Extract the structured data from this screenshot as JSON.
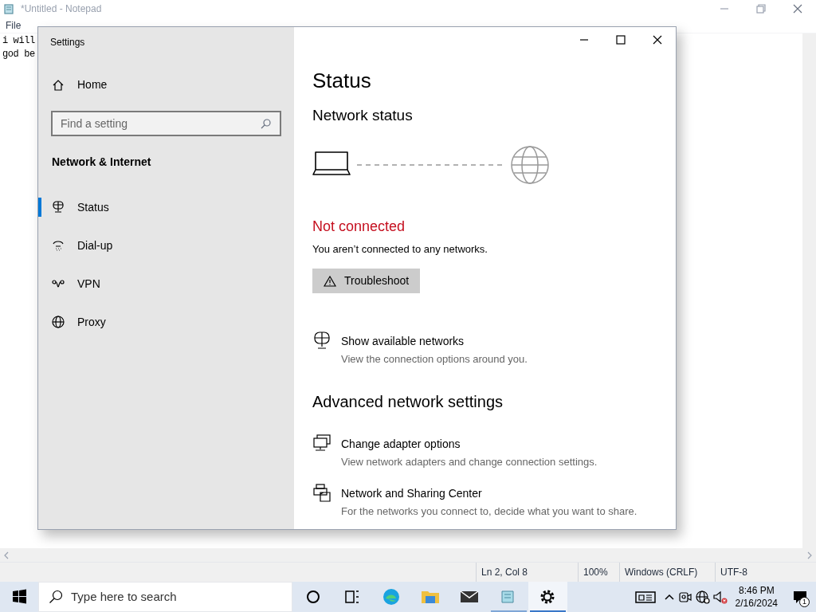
{
  "notepad": {
    "title": "*Untitled - Notepad",
    "menu": [
      "File"
    ],
    "lines": [
      "i will",
      "god be"
    ],
    "status_bar": [
      "Ln 2, Col 8",
      "100%",
      "Windows (CRLF)",
      "UTF-8"
    ]
  },
  "settings": {
    "title": "Settings",
    "sidebar": {
      "home": "Home",
      "search": {
        "placeholder": "Find a setting"
      },
      "section": "Network & Internet",
      "items": [
        {
          "label": "Status",
          "selected": true
        },
        {
          "label": "Dial-up",
          "selected": false
        },
        {
          "label": "VPN",
          "selected": false
        },
        {
          "label": "Proxy",
          "selected": false
        }
      ]
    },
    "main": {
      "heading": "Status",
      "subheading": "Network status",
      "connection_state": "Not connected",
      "connection_text": "You aren’t connected to any networks.",
      "button": "Troubleshoot",
      "links": [
        {
          "title": "Show available networks",
          "description": "View the connection options around you."
        }
      ],
      "advanced_heading": "Advanced network settings",
      "advanced_links": [
        {
          "title": "Change adapter options",
          "description": "View network adapters and change connection settings."
        },
        {
          "title": "Network and Sharing Center",
          "description": "For the networks you connect to, decide what you want to share."
        }
      ]
    }
  },
  "taskbar": {
    "search": {
      "placeholder": "Type here to search"
    },
    "apps": [
      {
        "active": false,
        "running": false
      },
      {
        "active": false,
        "running": false
      },
      {
        "active": false,
        "running": false
      },
      {
        "active": false,
        "running": false
      },
      {
        "active": false,
        "running": false
      },
      {
        "active": false,
        "running": true
      },
      {
        "active": true,
        "running": true
      }
    ],
    "time": "8:46 PM",
    "date": "2/16/2024",
    "notification_count": "1"
  }
}
